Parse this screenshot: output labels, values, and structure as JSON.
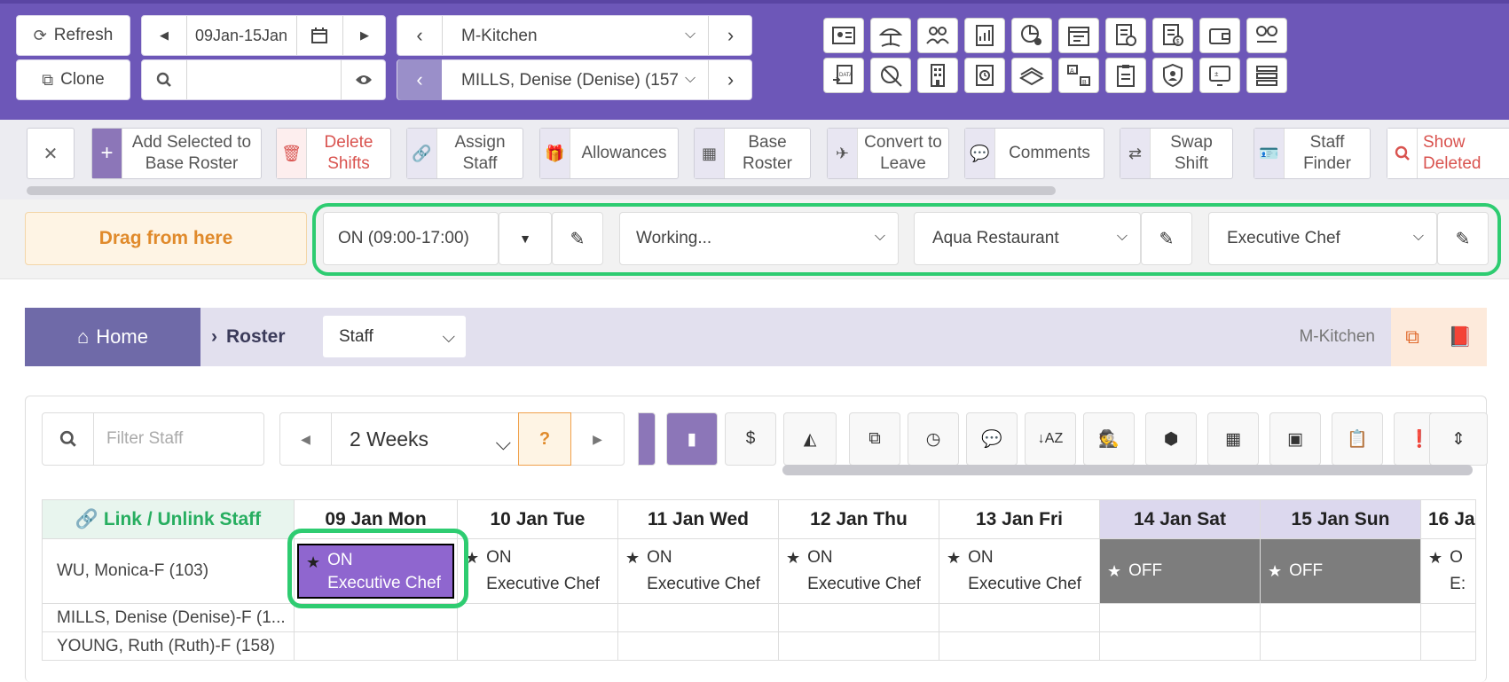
{
  "header": {
    "refresh_label": "Refresh",
    "clone_label": "Clone",
    "date_range": "09Jan-15Jan",
    "search_value": "",
    "location": "M-Kitchen",
    "staff_member": "MILLS, Denise (Denise) (157"
  },
  "actions": {
    "add_base": "Add Selected to Base Roster",
    "delete_shifts": "Delete Shifts",
    "assign_staff": "Assign Staff",
    "allowances": "Allowances",
    "base_roster": "Base Roster",
    "convert_leave": "Convert to Leave",
    "comments": "Comments",
    "swap_shift": "Swap Shift",
    "staff_finder": "Staff Finder",
    "show_deleted": "Show Deleted"
  },
  "drag": {
    "drag_label": "Drag from here",
    "shift_value": "ON (09:00-17:00)",
    "status_value": "Working...",
    "area_value": "Aqua Restaurant",
    "role_value": "Executive Chef"
  },
  "breadcrumb": {
    "home": "Home",
    "roster": "Roster",
    "view": "Staff",
    "location": "M-Kitchen"
  },
  "toolbar": {
    "filter_placeholder": "Filter Staff",
    "period": "2 Weeks",
    "help": "?"
  },
  "grid": {
    "link_header": "Link / Unlink Staff",
    "days": [
      "09 Jan Mon",
      "10 Jan Tue",
      "11 Jan Wed",
      "12 Jan Thu",
      "13 Jan Fri",
      "14 Jan Sat",
      "15 Jan Sun",
      "16 Ja"
    ],
    "staff": [
      "WU, Monica-F (103)",
      "MILLS, Denise (Denise)-F (1...",
      "YOUNG, Ruth (Ruth)-F (158)"
    ],
    "on_label": "ON",
    "off_label": "OFF",
    "role": "Executive Chef",
    "partial_on": "O",
    "partial_role": "E:"
  }
}
